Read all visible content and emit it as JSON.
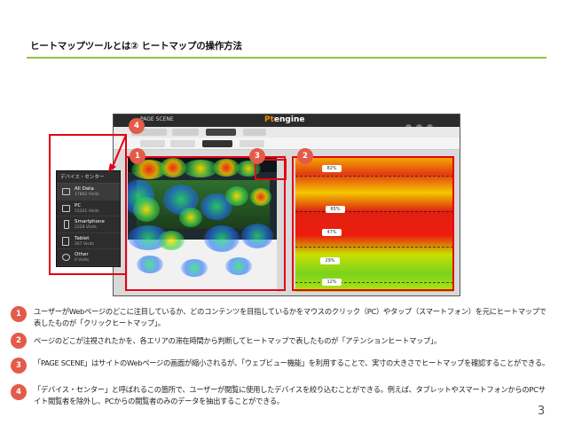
{
  "slide": {
    "title": "ヒートマップツールとは② ヒートマップの操作方法",
    "page_number": "3"
  },
  "screenshot": {
    "brand_label": "PAGE SCENE",
    "app_logo_prefix": "Pt",
    "app_logo_suffix": "engine",
    "device_center": {
      "header": "デバイス・センター",
      "items": [
        {
          "name": "All Data",
          "visits": "17802 Visits",
          "icon": "all-devices-icon"
        },
        {
          "name": "PC",
          "visits": "15201 Visits",
          "icon": "desktop-icon"
        },
        {
          "name": "Smartphone",
          "visits": "2328 Visits",
          "icon": "smartphone-icon"
        },
        {
          "name": "Tablet",
          "visits": "267 Visits",
          "icon": "tablet-icon"
        },
        {
          "name": "Other",
          "visits": "0 Visits",
          "icon": "question-icon"
        }
      ]
    },
    "attention_labels": [
      "0%",
      "12%",
      "29%",
      "47%",
      "65%",
      "82%"
    ]
  },
  "callouts": [
    "1",
    "2",
    "3",
    "4"
  ],
  "descriptions": [
    {
      "num": "1",
      "text": "ユーザーがWebページのどこに注目しているか、どのコンテンツを目指しているかをマウスのクリック（PC）やタップ（スマートフォン）を元にヒートマップで表したものが「クリックヒートマップ」。"
    },
    {
      "num": "2",
      "text": "ページのどこが注視されたかを、各エリアの滞在時間から判断してヒートマップで表したものが「アテンションヒートマップ」。"
    },
    {
      "num": "3",
      "text": "「PAGE SCENE」はサイトのWebページの画面が縮小されるが、「ウェブビュー機能」を利用することで、実寸の大きさでヒートマップを確認することができる。"
    },
    {
      "num": "4",
      "text": "「デバイス・センター」と呼ばれるこの箇所で、ユーザーが閲覧に使用したデバイスを絞り込むことができる。例えば、タブレットやスマートフォンからのPCサイト閲覧者を除外し、PCからの閲覧者のみのデータを抽出することができる。"
    }
  ],
  "colors": {
    "accent_rule": "#8cc63f",
    "annotation_red": "#e60012",
    "badge": "#e35b4a"
  }
}
